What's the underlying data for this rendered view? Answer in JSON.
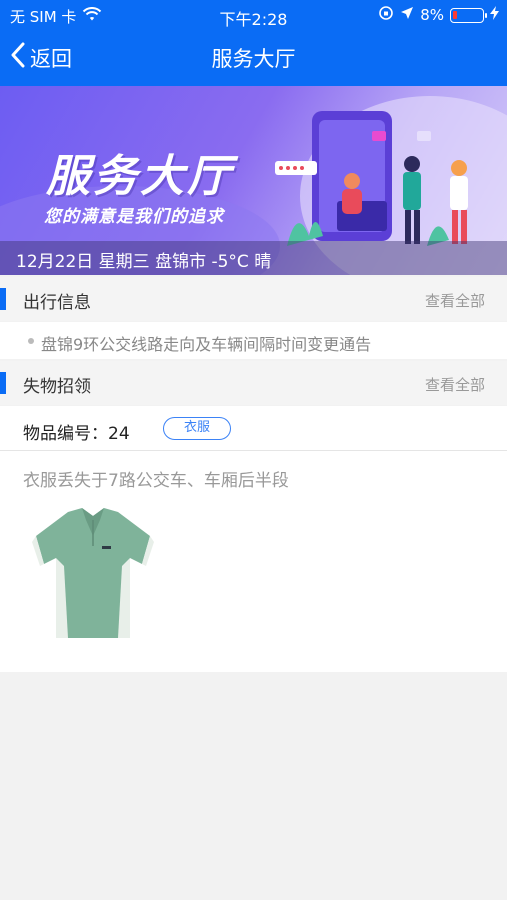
{
  "status_bar": {
    "carrier": "无 SIM 卡",
    "time": "下午2:28",
    "battery_pct": "8%",
    "icons": [
      "wifi-icon",
      "rotation-lock-icon",
      "location-arrow-icon",
      "battery-icon",
      "charging-bolt-icon"
    ]
  },
  "nav": {
    "back_label": "返回",
    "title": "服务大厅"
  },
  "banner": {
    "headline": "服务大厅",
    "slogan": "您的满意是我们的追求",
    "weather": "12月22日 星期三 盘锦市 -5°C 晴"
  },
  "travel": {
    "title": "出行信息",
    "more": "查看全部",
    "items": [
      "盘锦9环公交线路走向及车辆间隔时间变更通告"
    ]
  },
  "lost_found": {
    "title": "失物招领",
    "more": "查看全部",
    "item_id_label": "物品编号：24",
    "category_tag": "衣服",
    "description": "衣服丢失于7路公交车、车厢后半段"
  },
  "colors": {
    "primary": "#0a6cf5",
    "banner_purple": "#7a63f0",
    "tag_blue": "#3b82f6"
  }
}
